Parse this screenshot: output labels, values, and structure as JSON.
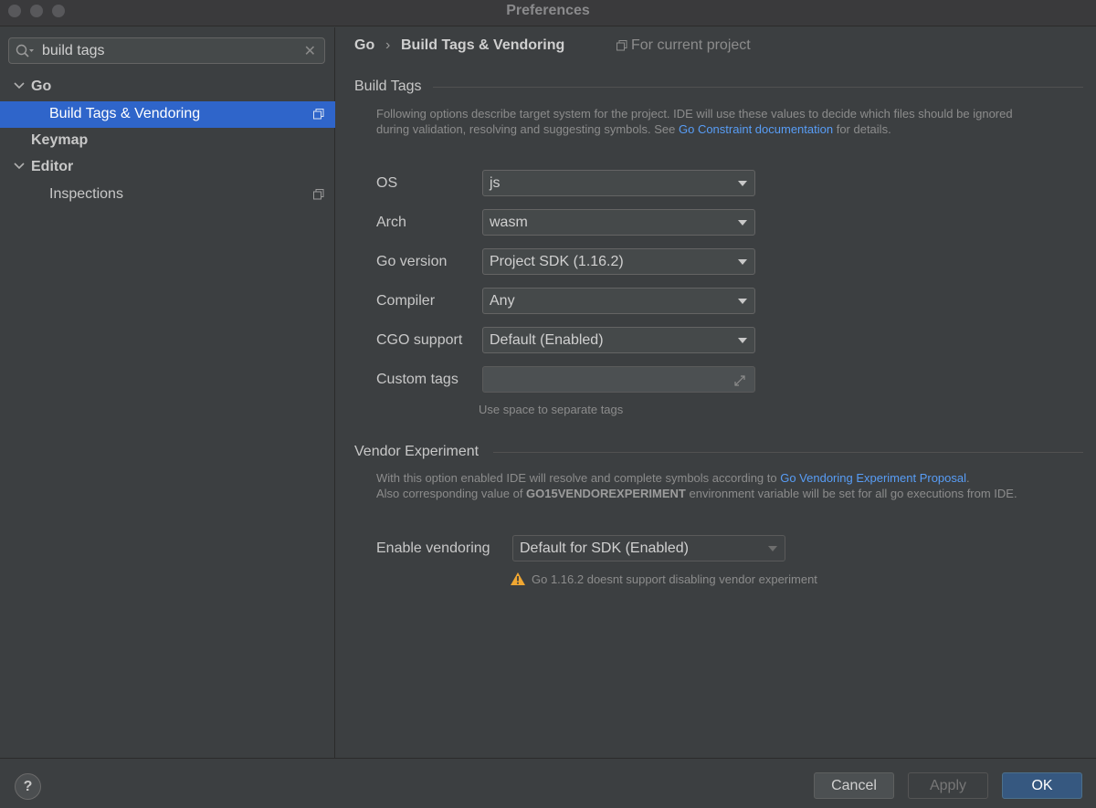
{
  "window": {
    "title": "Preferences"
  },
  "sidebar": {
    "search": {
      "value": "build tags",
      "placeholder": ""
    },
    "items": [
      {
        "label": "Go",
        "expanded": true
      },
      {
        "label": "Build Tags & Vendoring",
        "selected": true
      },
      {
        "label": "Keymap"
      },
      {
        "label": "Editor",
        "expanded": true
      },
      {
        "label": "Inspections"
      }
    ]
  },
  "header": {
    "crumb_root": "Go",
    "crumb_sep": "›",
    "crumb_page": "Build Tags & Vendoring",
    "scope": "For current project"
  },
  "build_tags": {
    "title": "Build Tags",
    "desc_line1": "Following options describe target system for the project. IDE will use these values to decide which files should be ignored",
    "desc_line2_pre": "during validation, resolving and suggesting symbols. See ",
    "desc_link": "Go Constraint documentation",
    "desc_line2_post": " for details.",
    "fields": {
      "os": {
        "label": "OS",
        "value": "js"
      },
      "arch": {
        "label": "Arch",
        "value": "wasm"
      },
      "go_version": {
        "label": "Go version",
        "value": "Project SDK (1.16.2)"
      },
      "compiler": {
        "label": "Compiler",
        "value": "Any"
      },
      "cgo": {
        "label": "CGO support",
        "value": "Default (Enabled)"
      },
      "custom_tags": {
        "label": "Custom tags",
        "value": ""
      }
    },
    "custom_hint": "Use space to separate tags"
  },
  "vendor": {
    "title": "Vendor Experiment",
    "line1_pre": "With this option enabled IDE will resolve and complete symbols according to ",
    "line1_link": "Go Vendoring Experiment Proposal",
    "line1_post": ".",
    "line2_pre": "Also corresponding value of ",
    "line2_strong": "GO15VENDOREXPERIMENT",
    "line2_post": " environment variable will be set for all go executions from IDE.",
    "enable_label": "Enable vendoring",
    "enable_value": "Default for SDK (Enabled)",
    "warning": "Go 1.16.2 doesnt support disabling vendor experiment"
  },
  "footer": {
    "help": "?",
    "cancel": "Cancel",
    "apply": "Apply",
    "ok": "OK"
  },
  "colors": {
    "selection": "#2f65ca",
    "link": "#589df6",
    "primary_button": "#365880",
    "warning": "#f0a732"
  }
}
